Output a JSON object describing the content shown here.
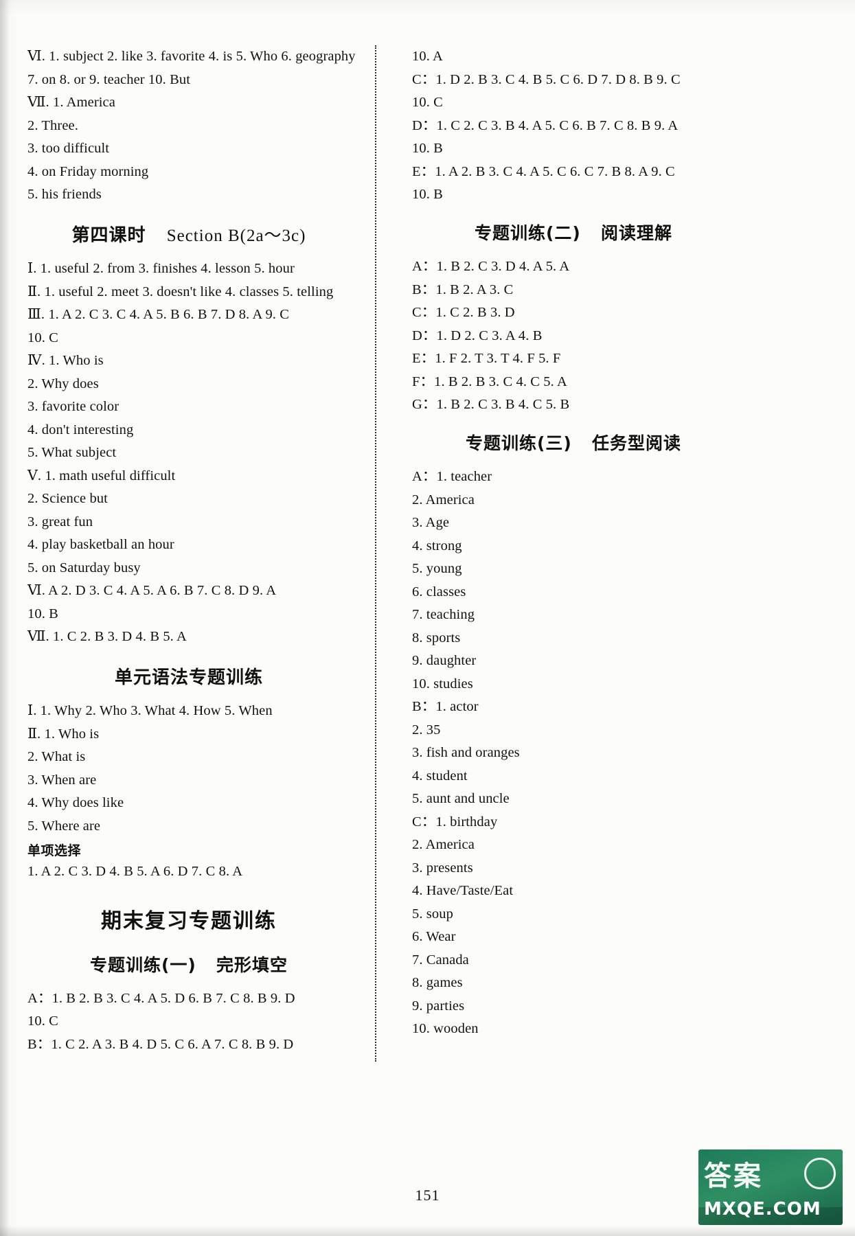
{
  "page": {
    "number": "151",
    "watermark": {
      "cn": "答案",
      "domain": "MXQE.COM"
    }
  },
  "left_column": {
    "blocks": [
      {
        "type": "line",
        "id": "l1",
        "text": "Ⅵ. 1. subject   2. like   3. favorite   4. is   5. Who   6. geography"
      },
      {
        "type": "line",
        "id": "l2",
        "text": "7. on   8. or   9. teacher   10. But"
      },
      {
        "type": "line",
        "id": "l3",
        "text": "Ⅶ. 1. America"
      },
      {
        "type": "line",
        "id": "l4",
        "text": "2. Three."
      },
      {
        "type": "line",
        "id": "l5",
        "text": "3. too difficult"
      },
      {
        "type": "line",
        "id": "l6",
        "text": "4. on Friday morning"
      },
      {
        "type": "line",
        "id": "l7",
        "text": "5. his friends"
      },
      {
        "type": "header",
        "id": "h1",
        "cn": "第四课时",
        "en": "Section B(2a～3c)"
      },
      {
        "type": "line",
        "id": "l8",
        "text": "Ⅰ. 1. useful   2. from   3. finishes   4. lesson   5. hour"
      },
      {
        "type": "line",
        "id": "l9",
        "text": "Ⅱ. 1. useful   2. meet   3. doesn't like   4. classes   5. telling"
      },
      {
        "type": "line",
        "id": "l10",
        "text": "Ⅲ. 1. A   2. C   3. C   4. A   5. B   6. B   7. D   8. A   9. C"
      },
      {
        "type": "line",
        "id": "l11",
        "text": "10. C"
      },
      {
        "type": "line",
        "id": "l12",
        "text": "Ⅳ. 1. Who   is"
      },
      {
        "type": "line",
        "id": "l13",
        "text": "2. Why   does"
      },
      {
        "type": "line",
        "id": "l14",
        "text": "3. favorite   color"
      },
      {
        "type": "line",
        "id": "l15",
        "text": "4. don't   interesting"
      },
      {
        "type": "line",
        "id": "l16",
        "text": "5. What   subject"
      },
      {
        "type": "line",
        "id": "l17",
        "text": "Ⅴ. 1. math   useful   difficult"
      },
      {
        "type": "line",
        "id": "l18",
        "text": "2. Science   but"
      },
      {
        "type": "line",
        "id": "l19",
        "text": "3. great   fun"
      },
      {
        "type": "line",
        "id": "l20",
        "text": "4. play   basketball   an   hour"
      },
      {
        "type": "line",
        "id": "l21",
        "text": "5. on   Saturday   busy"
      },
      {
        "type": "line",
        "id": "l22",
        "text": "Ⅵ. A   2. D   3. C   4. A   5. A   6. B   7. C   8. D   9. A"
      },
      {
        "type": "line",
        "id": "l23",
        "text": "10. B"
      },
      {
        "type": "line",
        "id": "l24",
        "text": "Ⅶ. 1. C   2. B   3. D   4. B   5. A"
      },
      {
        "type": "header_cn",
        "id": "h2",
        "cn": "单元语法专题训练"
      },
      {
        "type": "line",
        "id": "l25",
        "text": "Ⅰ. 1. Why   2. Who   3. What   4. How   5. When"
      },
      {
        "type": "line",
        "id": "l26",
        "text": "Ⅱ. 1. Who   is"
      },
      {
        "type": "line",
        "id": "l27",
        "text": "2. What   is"
      },
      {
        "type": "line",
        "id": "l28",
        "text": "3. When   are"
      },
      {
        "type": "line",
        "id": "l29",
        "text": "4. Why   does   like"
      },
      {
        "type": "line",
        "id": "l30",
        "text": "5. Where   are"
      },
      {
        "type": "label_cn",
        "id": "lab1",
        "text": "单项选择"
      },
      {
        "type": "line",
        "id": "l31",
        "text": "1. A   2. C   3. D   4. B   5. A   6. D   7. C   8. A"
      },
      {
        "type": "header_big",
        "id": "h3",
        "cn": "期末复习专题训练"
      },
      {
        "type": "header_sub",
        "id": "h4",
        "cn": "专题训练(一)",
        "en": "完形填空"
      },
      {
        "type": "line",
        "id": "l32",
        "text": "A：1. B   2. B   3. C   4. A   5. D   6. B   7. C   8. B   9. D"
      },
      {
        "type": "line",
        "id": "l33",
        "text": "10. C"
      },
      {
        "type": "line",
        "id": "l34",
        "text": "B：1. C   2. A   3. B   4. D   5. C   6. A   7. C   8. B   9. D"
      }
    ]
  },
  "right_column": {
    "blocks": [
      {
        "type": "line",
        "id": "r1",
        "text": "10. A"
      },
      {
        "type": "line",
        "id": "r2",
        "text": "C：1. D   2. B   3. C   4. B   5. C   6. D   7. D   8. B   9. C"
      },
      {
        "type": "line",
        "id": "r3",
        "text": "10. C"
      },
      {
        "type": "line",
        "id": "r4",
        "text": "D：1. C   2. C   3. B   4. A   5. C   6. B   7. C   8. B   9. A"
      },
      {
        "type": "line",
        "id": "r5",
        "text": "10. B"
      },
      {
        "type": "line",
        "id": "r6",
        "text": "E：1. A   2. B   3. C   4. A   5. C   6. C   7. B   8. A   9. C"
      },
      {
        "type": "line",
        "id": "r7",
        "text": "10. B"
      },
      {
        "type": "header_sub",
        "id": "rh1",
        "cn": "专题训练(二)",
        "en": "阅读理解"
      },
      {
        "type": "line",
        "id": "r8",
        "text": "A：1. B   2. C   3. D   4. A   5. A"
      },
      {
        "type": "line",
        "id": "r9",
        "text": "B：1. B   2. A   3. C"
      },
      {
        "type": "line",
        "id": "r10",
        "text": "C：1. C   2. B   3. D"
      },
      {
        "type": "line",
        "id": "r11",
        "text": "D：1. D   2. C   3. A   4. B"
      },
      {
        "type": "line",
        "id": "r12",
        "text": "E：1. F   2. T   3. T   4. F   5. F"
      },
      {
        "type": "line",
        "id": "r13",
        "text": "F：1. B   2. B   3. C   4. C   5. A"
      },
      {
        "type": "line",
        "id": "r14",
        "text": "G：1. B   2. C   3. B   4. C   5. B"
      },
      {
        "type": "header_sub",
        "id": "rh2",
        "cn": "专题训练(三)",
        "en": "任务型阅读"
      },
      {
        "type": "line",
        "id": "r15",
        "text": "A：1. teacher"
      },
      {
        "type": "line",
        "id": "r16",
        "text": "2. America"
      },
      {
        "type": "line",
        "id": "r17",
        "text": "3. Age"
      },
      {
        "type": "line",
        "id": "r18",
        "text": "4. strong"
      },
      {
        "type": "line",
        "id": "r19",
        "text": "5. young"
      },
      {
        "type": "line",
        "id": "r20",
        "text": "6. classes"
      },
      {
        "type": "line",
        "id": "r21",
        "text": "7. teaching"
      },
      {
        "type": "line",
        "id": "r22",
        "text": "8. sports"
      },
      {
        "type": "line",
        "id": "r23",
        "text": "9. daughter"
      },
      {
        "type": "line",
        "id": "r24",
        "text": "10. studies"
      },
      {
        "type": "line",
        "id": "r25",
        "text": "B：1. actor"
      },
      {
        "type": "line",
        "id": "r26",
        "text": "2. 35"
      },
      {
        "type": "line",
        "id": "r27",
        "text": "3. fish and oranges"
      },
      {
        "type": "line",
        "id": "r28",
        "text": "4. student"
      },
      {
        "type": "line",
        "id": "r29",
        "text": "5. aunt and uncle"
      },
      {
        "type": "line",
        "id": "r30",
        "text": "C：1. birthday"
      },
      {
        "type": "line",
        "id": "r31",
        "text": "2. America"
      },
      {
        "type": "line",
        "id": "r32",
        "text": "3. presents"
      },
      {
        "type": "line",
        "id": "r33",
        "text": "4. Have/Taste/Eat"
      },
      {
        "type": "line",
        "id": "r34",
        "text": "5. soup"
      },
      {
        "type": "line",
        "id": "r35",
        "text": "6. Wear"
      },
      {
        "type": "line",
        "id": "r36",
        "text": "7. Canada"
      },
      {
        "type": "line",
        "id": "r37",
        "text": "8. games"
      },
      {
        "type": "line",
        "id": "r38",
        "text": "9. parties"
      },
      {
        "type": "line",
        "id": "r39",
        "text": "10. wooden"
      }
    ]
  }
}
